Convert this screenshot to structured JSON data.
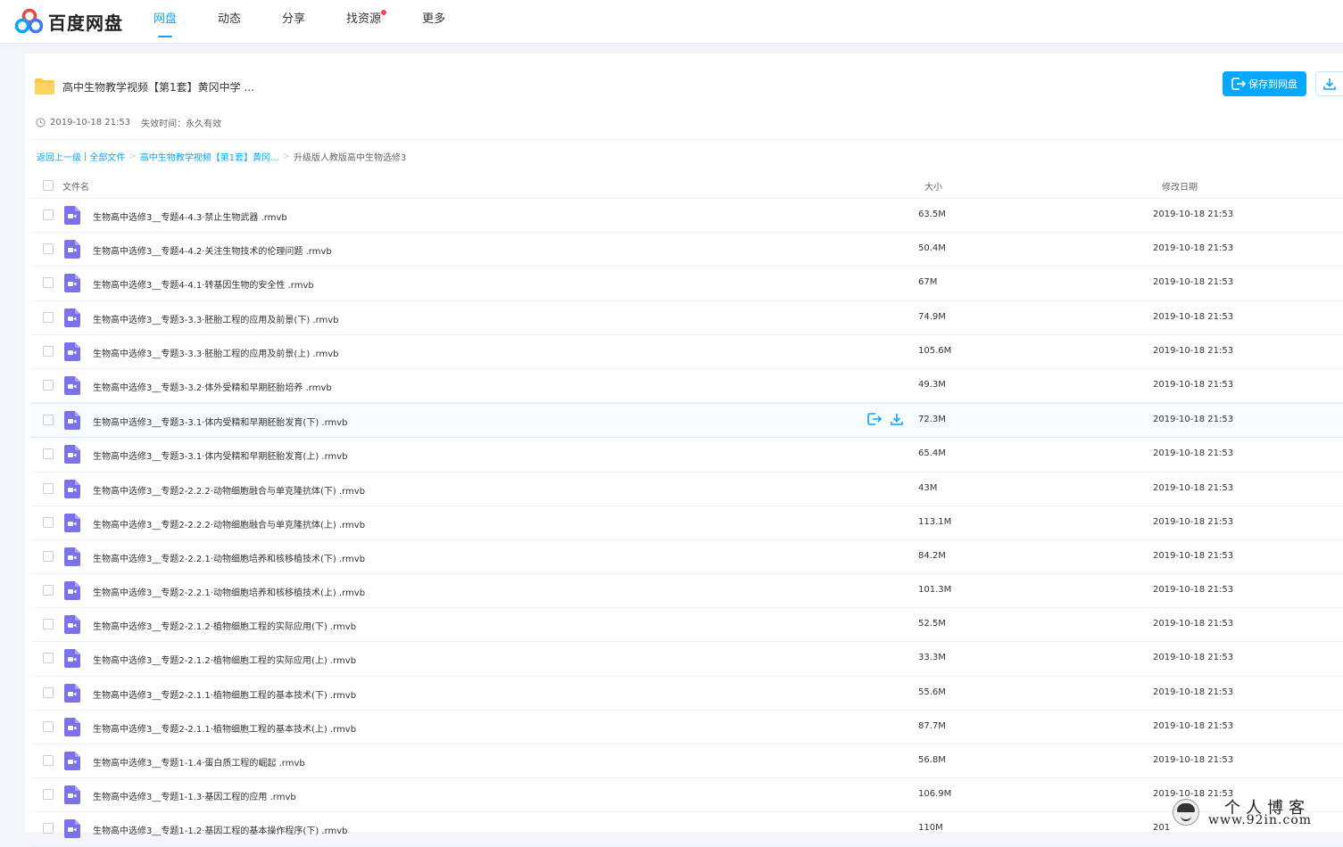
{
  "app": {
    "brand": "百度网盘",
    "nav": [
      {
        "label": "网盘",
        "active": true,
        "dot": false
      },
      {
        "label": "动态",
        "active": false,
        "dot": false
      },
      {
        "label": "分享",
        "active": false,
        "dot": false
      },
      {
        "label": "找资源",
        "active": false,
        "dot": true
      },
      {
        "label": "更多",
        "active": false,
        "dot": false
      }
    ]
  },
  "share": {
    "title": "高中生物教学视频【第1套】黄冈中学 ...",
    "created": "2019-10-18 21:53",
    "expire": "失效时间：永久有效",
    "save_label": "保存到网盘",
    "icon": "folder-icon"
  },
  "breadcrumb": {
    "back": "返回上一级",
    "all": "全部文件",
    "parent": "高中生物教学视频【第1套】黄冈...",
    "current": "升级版人教版高中生物选修3"
  },
  "table": {
    "headers": {
      "name": "文件名",
      "size": "大小",
      "date": "修改日期"
    },
    "rows": [
      {
        "name": "生物高中选修3__专题4-4.3·禁止生物武器 .rmvb",
        "size": "63.5M",
        "date": "2019-10-18 21:53"
      },
      {
        "name": "生物高中选修3__专题4-4.2·关注生物技术的伦理问题 .rmvb",
        "size": "50.4M",
        "date": "2019-10-18 21:53"
      },
      {
        "name": "生物高中选修3__专题4-4.1·转基因生物的安全性 .rmvb",
        "size": "67M",
        "date": "2019-10-18 21:53"
      },
      {
        "name": "生物高中选修3__专题3-3.3·胚胎工程的应用及前景(下) .rmvb",
        "size": "74.9M",
        "date": "2019-10-18 21:53"
      },
      {
        "name": "生物高中选修3__专题3-3.3·胚胎工程的应用及前景(上) .rmvb",
        "size": "105.6M",
        "date": "2019-10-18 21:53"
      },
      {
        "name": "生物高中选修3__专题3-3.2·体外受精和早期胚胎培养 .rmvb",
        "size": "49.3M",
        "date": "2019-10-18 21:53"
      },
      {
        "name": "生物高中选修3__专题3-3.1·体内受精和早期胚胎发育(下) .rmvb",
        "size": "72.3M",
        "date": "2019-10-18 21:53",
        "hover": true
      },
      {
        "name": "生物高中选修3__专题3-3.1·体内受精和早期胚胎发育(上) .rmvb",
        "size": "65.4M",
        "date": "2019-10-18 21:53"
      },
      {
        "name": "生物高中选修3__专题2-2.2.2·动物细胞融合与单克隆抗体(下) .rmvb",
        "size": "43M",
        "date": "2019-10-18 21:53"
      },
      {
        "name": "生物高中选修3__专题2-2.2.2·动物细胞融合与单克隆抗体(上) .rmvb",
        "size": "113.1M",
        "date": "2019-10-18 21:53"
      },
      {
        "name": "生物高中选修3__专题2-2.2.1·动物细胞培养和核移植技术(下) .rmvb",
        "size": "84.2M",
        "date": "2019-10-18 21:53"
      },
      {
        "name": "生物高中选修3__专题2-2.2.1·动物细胞培养和核移植技术(上) .rmvb",
        "size": "101.3M",
        "date": "2019-10-18 21:53"
      },
      {
        "name": "生物高中选修3__专题2-2.1.2·植物细胞工程的实际应用(下) .rmvb",
        "size": "52.5M",
        "date": "2019-10-18 21:53"
      },
      {
        "name": "生物高中选修3__专题2-2.1.2·植物细胞工程的实际应用(上) .rmvb",
        "size": "33.3M",
        "date": "2019-10-18 21:53"
      },
      {
        "name": "生物高中选修3__专题2-2.1.1·植物细胞工程的基本技术(下) .rmvb",
        "size": "55.6M",
        "date": "2019-10-18 21:53"
      },
      {
        "name": "生物高中选修3__专题2-2.1.1·植物细胞工程的基本技术(上) .rmvb",
        "size": "87.7M",
        "date": "2019-10-18 21:53"
      },
      {
        "name": "生物高中选修3__专题1-1.4·蛋白质工程的崛起 .rmvb",
        "size": "56.8M",
        "date": "2019-10-18 21:53"
      },
      {
        "name": "生物高中选修3__专题1-1.3·基因工程的应用 .rmvb",
        "size": "106.9M",
        "date": "2019-10-18 21:53"
      },
      {
        "name": "生物高中选修3__专题1-1.2·基因工程的基本操作程序(下) .rmvb",
        "size": "110M",
        "date": "201"
      }
    ]
  },
  "watermark": {
    "title": "个人博客",
    "url": "www.92in.com"
  },
  "colors": {
    "accent": "#06a7ff",
    "video_icon": "#7b72e9",
    "folder": "#ffc64a",
    "nav_dot": "#f5455c"
  }
}
